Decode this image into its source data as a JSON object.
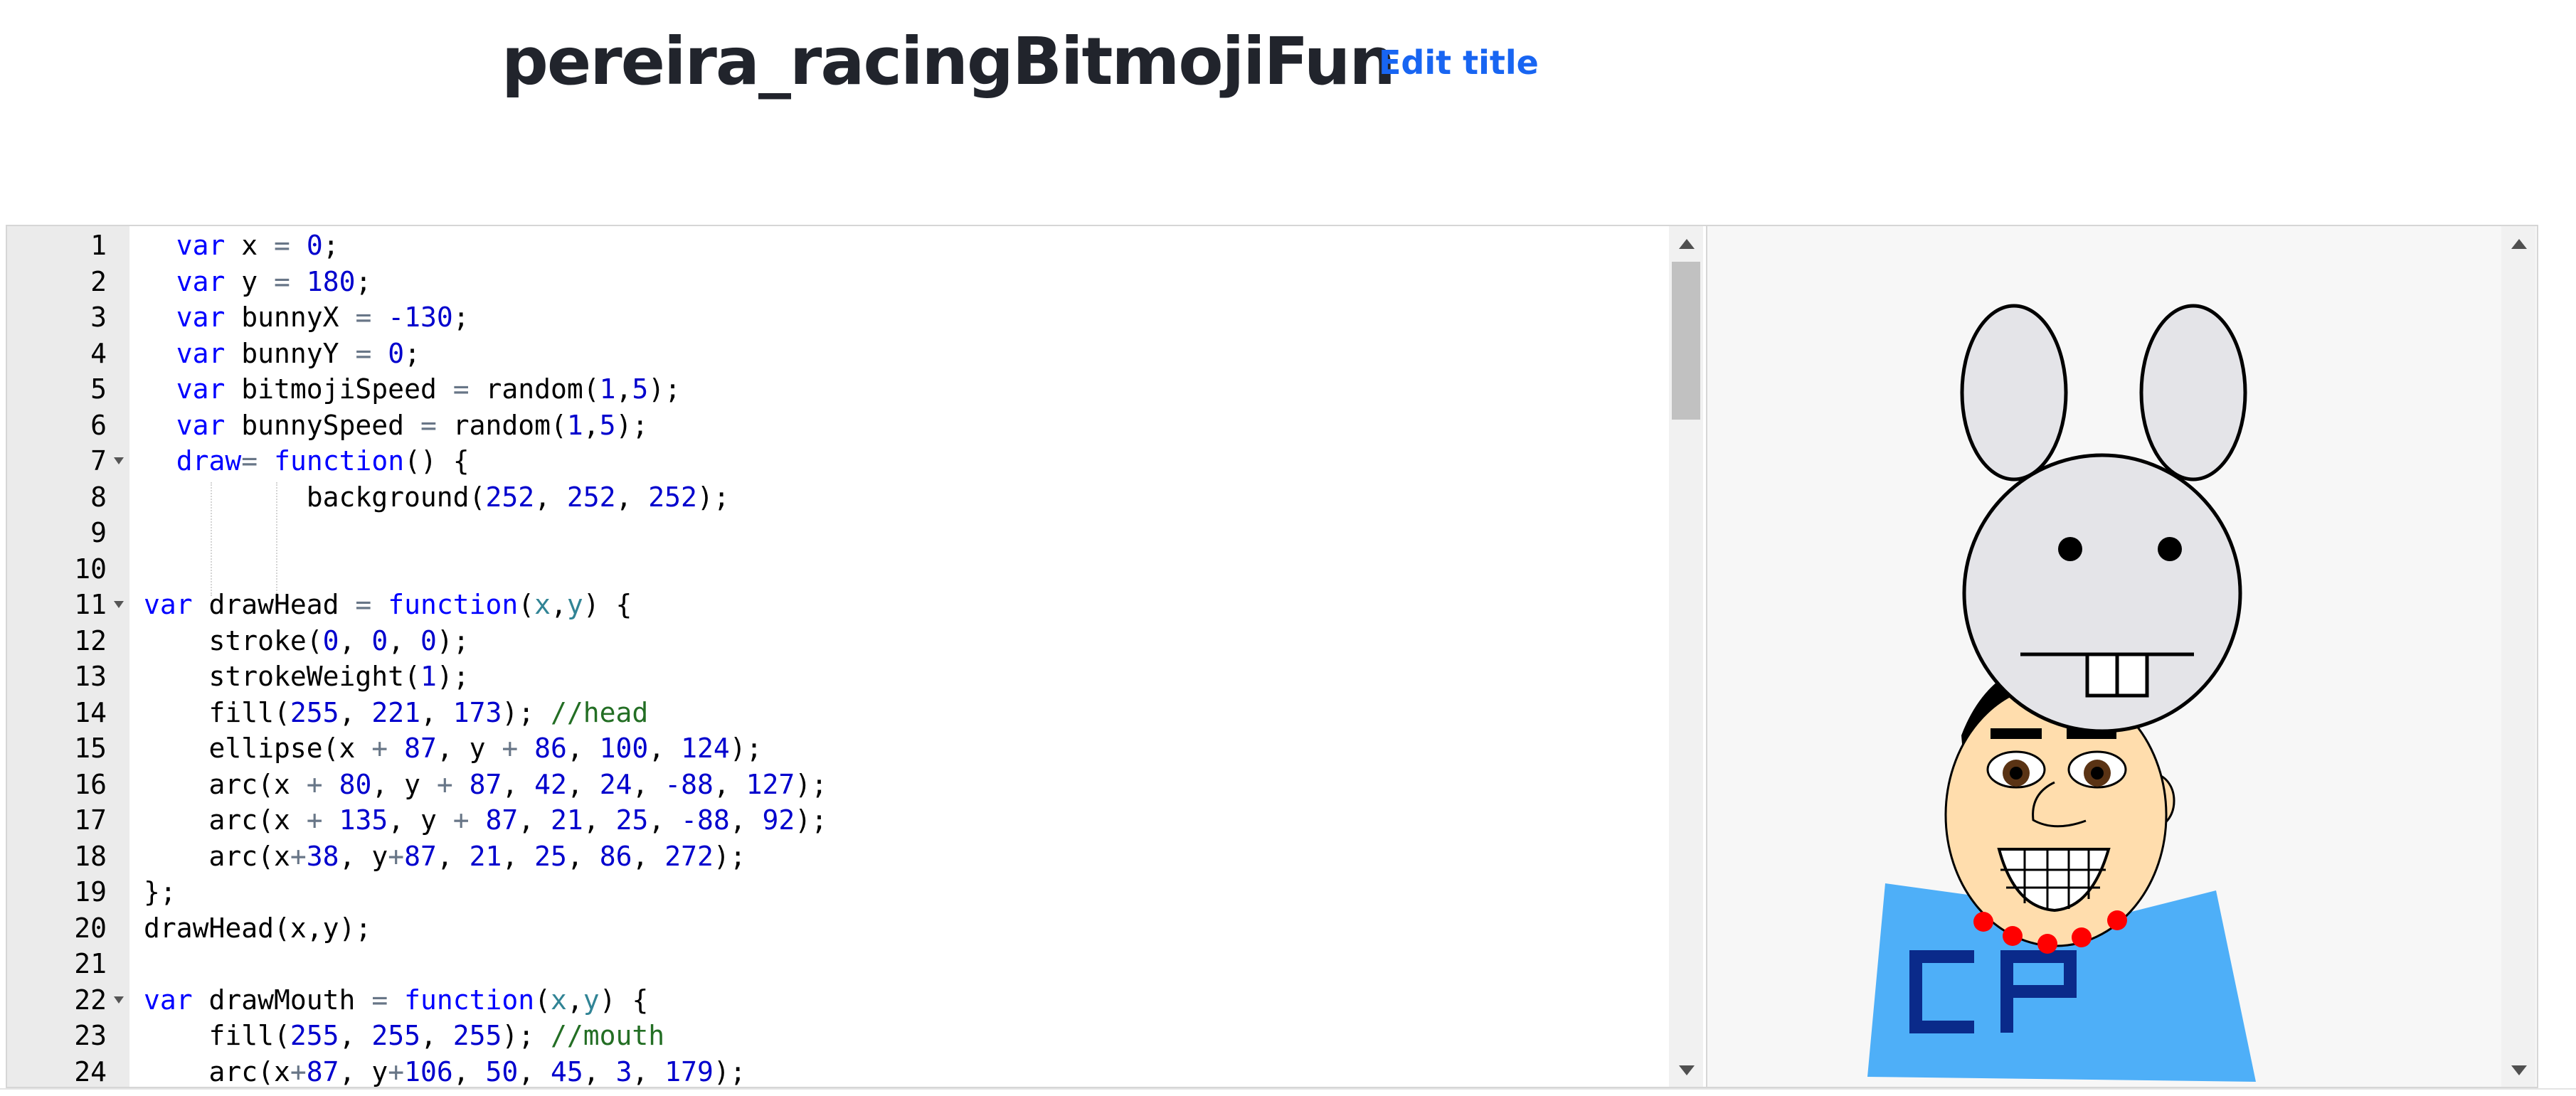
{
  "header": {
    "title": "pereira_racingBitmojiFun",
    "edit_title_label": "Edit title"
  },
  "editor": {
    "lines": [
      {
        "n": "1",
        "parts": [
          [
            "  ",
            ""
          ],
          [
            "var",
            "kw"
          ],
          [
            " x ",
            ""
          ],
          [
            "=",
            "op"
          ],
          [
            " ",
            ""
          ],
          [
            "0",
            "num"
          ],
          [
            ";",
            ""
          ]
        ]
      },
      {
        "n": "2",
        "parts": [
          [
            "  ",
            ""
          ],
          [
            "var",
            "kw"
          ],
          [
            " y ",
            ""
          ],
          [
            "=",
            "op"
          ],
          [
            " ",
            ""
          ],
          [
            "180",
            "num"
          ],
          [
            ";",
            ""
          ]
        ]
      },
      {
        "n": "3",
        "parts": [
          [
            "  ",
            ""
          ],
          [
            "var",
            "kw"
          ],
          [
            " bunnyX ",
            ""
          ],
          [
            "=",
            "op"
          ],
          [
            " ",
            ""
          ],
          [
            "-130",
            "num"
          ],
          [
            ";",
            ""
          ]
        ]
      },
      {
        "n": "4",
        "parts": [
          [
            "  ",
            ""
          ],
          [
            "var",
            "kw"
          ],
          [
            " bunnyY ",
            ""
          ],
          [
            "=",
            "op"
          ],
          [
            " ",
            ""
          ],
          [
            "0",
            "num"
          ],
          [
            ";",
            ""
          ]
        ]
      },
      {
        "n": "5",
        "parts": [
          [
            "  ",
            ""
          ],
          [
            "var",
            "kw"
          ],
          [
            " bitmojiSpeed ",
            ""
          ],
          [
            "=",
            "op"
          ],
          [
            " random(",
            ""
          ],
          [
            "1",
            "num"
          ],
          [
            ",",
            ""
          ],
          [
            "5",
            "num"
          ],
          [
            ");",
            ""
          ]
        ]
      },
      {
        "n": "6",
        "parts": [
          [
            "  ",
            ""
          ],
          [
            "var",
            "kw"
          ],
          [
            " bunnySpeed ",
            ""
          ],
          [
            "=",
            "op"
          ],
          [
            " random(",
            ""
          ],
          [
            "1",
            "num"
          ],
          [
            ",",
            ""
          ],
          [
            "5",
            "num"
          ],
          [
            ");",
            ""
          ]
        ]
      },
      {
        "n": "7",
        "fold": true,
        "parts": [
          [
            "  ",
            ""
          ],
          [
            "draw",
            "kw"
          ],
          [
            "=",
            "op"
          ],
          [
            " ",
            ""
          ],
          [
            "function",
            "kw"
          ],
          [
            "() {",
            ""
          ]
        ]
      },
      {
        "n": "8",
        "parts": [
          [
            "          background(",
            ""
          ],
          [
            "252",
            "num"
          ],
          [
            ", ",
            ""
          ],
          [
            "252",
            "num"
          ],
          [
            ", ",
            ""
          ],
          [
            "252",
            "num"
          ],
          [
            ");",
            ""
          ]
        ]
      },
      {
        "n": "9",
        "parts": []
      },
      {
        "n": "10",
        "parts": []
      },
      {
        "n": "11",
        "fold": true,
        "parts": [
          [
            "var",
            "kw"
          ],
          [
            " drawHead ",
            ""
          ],
          [
            "=",
            "op"
          ],
          [
            " ",
            ""
          ],
          [
            "function",
            "kw"
          ],
          [
            "(",
            ""
          ],
          [
            "x",
            "pm"
          ],
          [
            ",",
            ""
          ],
          [
            "y",
            "pm"
          ],
          [
            ") {",
            ""
          ]
        ]
      },
      {
        "n": "12",
        "parts": [
          [
            "    stroke(",
            ""
          ],
          [
            "0",
            "num"
          ],
          [
            ", ",
            ""
          ],
          [
            "0",
            "num"
          ],
          [
            ", ",
            ""
          ],
          [
            "0",
            "num"
          ],
          [
            ");",
            ""
          ]
        ]
      },
      {
        "n": "13",
        "parts": [
          [
            "    strokeWeight(",
            ""
          ],
          [
            "1",
            "num"
          ],
          [
            ");",
            ""
          ]
        ]
      },
      {
        "n": "14",
        "parts": [
          [
            "    fill(",
            ""
          ],
          [
            "255",
            "num"
          ],
          [
            ", ",
            ""
          ],
          [
            "221",
            "num"
          ],
          [
            ", ",
            ""
          ],
          [
            "173",
            "num"
          ],
          [
            "); ",
            ""
          ],
          [
            "//head",
            "cm"
          ]
        ]
      },
      {
        "n": "15",
        "parts": [
          [
            "    ellipse(x ",
            ""
          ],
          [
            "+",
            "op"
          ],
          [
            " ",
            ""
          ],
          [
            "87",
            "num"
          ],
          [
            ", y ",
            ""
          ],
          [
            "+",
            "op"
          ],
          [
            " ",
            ""
          ],
          [
            "86",
            "num"
          ],
          [
            ", ",
            ""
          ],
          [
            "100",
            "num"
          ],
          [
            ", ",
            ""
          ],
          [
            "124",
            "num"
          ],
          [
            ");",
            ""
          ]
        ]
      },
      {
        "n": "16",
        "parts": [
          [
            "    arc(x ",
            ""
          ],
          [
            "+",
            "op"
          ],
          [
            " ",
            ""
          ],
          [
            "80",
            "num"
          ],
          [
            ", y ",
            ""
          ],
          [
            "+",
            "op"
          ],
          [
            " ",
            ""
          ],
          [
            "87",
            "num"
          ],
          [
            ", ",
            ""
          ],
          [
            "42",
            "num"
          ],
          [
            ", ",
            ""
          ],
          [
            "24",
            "num"
          ],
          [
            ", ",
            ""
          ],
          [
            "-88",
            "num"
          ],
          [
            ", ",
            ""
          ],
          [
            "127",
            "num"
          ],
          [
            ");",
            ""
          ]
        ]
      },
      {
        "n": "17",
        "parts": [
          [
            "    arc(x ",
            ""
          ],
          [
            "+",
            "op"
          ],
          [
            " ",
            ""
          ],
          [
            "135",
            "num"
          ],
          [
            ", y ",
            ""
          ],
          [
            "+",
            "op"
          ],
          [
            " ",
            ""
          ],
          [
            "87",
            "num"
          ],
          [
            ", ",
            ""
          ],
          [
            "21",
            "num"
          ],
          [
            ", ",
            ""
          ],
          [
            "25",
            "num"
          ],
          [
            ", ",
            ""
          ],
          [
            "-88",
            "num"
          ],
          [
            ", ",
            ""
          ],
          [
            "92",
            "num"
          ],
          [
            ");",
            ""
          ]
        ]
      },
      {
        "n": "18",
        "parts": [
          [
            "    arc(x",
            ""
          ],
          [
            "+",
            "op"
          ],
          [
            "38",
            "num"
          ],
          [
            ", y",
            ""
          ],
          [
            "+",
            "op"
          ],
          [
            "87",
            "num"
          ],
          [
            ", ",
            ""
          ],
          [
            "21",
            "num"
          ],
          [
            ", ",
            ""
          ],
          [
            "25",
            "num"
          ],
          [
            ", ",
            ""
          ],
          [
            "86",
            "num"
          ],
          [
            ", ",
            ""
          ],
          [
            "272",
            "num"
          ],
          [
            ");",
            ""
          ]
        ]
      },
      {
        "n": "19",
        "parts": [
          [
            "};",
            ""
          ]
        ]
      },
      {
        "n": "20",
        "parts": [
          [
            "drawHead(x,y);",
            ""
          ]
        ]
      },
      {
        "n": "21",
        "parts": []
      },
      {
        "n": "22",
        "fold": true,
        "parts": [
          [
            "var",
            "kw"
          ],
          [
            " drawMouth ",
            ""
          ],
          [
            "=",
            "op"
          ],
          [
            " ",
            ""
          ],
          [
            "function",
            "kw"
          ],
          [
            "(",
            ""
          ],
          [
            "x",
            "pm"
          ],
          [
            ",",
            ""
          ],
          [
            "y",
            "pm"
          ],
          [
            ") {",
            ""
          ]
        ]
      },
      {
        "n": "23",
        "parts": [
          [
            "    fill(",
            ""
          ],
          [
            "255",
            "num"
          ],
          [
            ", ",
            ""
          ],
          [
            "255",
            "num"
          ],
          [
            ", ",
            ""
          ],
          [
            "255",
            "num"
          ],
          [
            "); ",
            ""
          ],
          [
            "//mouth",
            "cm"
          ]
        ]
      },
      {
        "n": "24",
        "parts": [
          [
            "    arc(x",
            ""
          ],
          [
            "+",
            "op"
          ],
          [
            "87",
            "num"
          ],
          [
            ", y",
            ""
          ],
          [
            "+",
            "op"
          ],
          [
            "106",
            "num"
          ],
          [
            ", ",
            ""
          ],
          [
            "50",
            "num"
          ],
          [
            ", ",
            ""
          ],
          [
            "45",
            "num"
          ],
          [
            ", ",
            ""
          ],
          [
            "3",
            "num"
          ],
          [
            ", ",
            ""
          ],
          [
            "179",
            "num"
          ],
          [
            ");",
            ""
          ]
        ]
      }
    ]
  },
  "canvas": {
    "colors": {
      "background": "#f7f7f7",
      "bunny": "#e4e4e8",
      "skin": "#ffddad",
      "hair": "#000000",
      "shirt": "#4eaff8",
      "logo": "#0a2a8a",
      "beads": "#ff0000"
    },
    "shirt_logo": "CP"
  },
  "icons": {
    "scroll_up": "triangle-up",
    "scroll_down": "triangle-down",
    "fold_marker": "triangle-down"
  }
}
